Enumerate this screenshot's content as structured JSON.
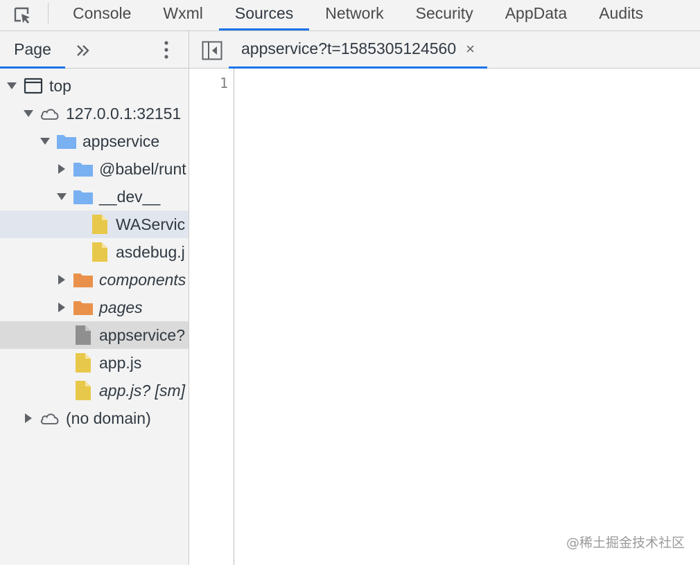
{
  "toolbar": {
    "tabs": [
      "Console",
      "Wxml",
      "Sources",
      "Network",
      "Security",
      "AppData",
      "Audits"
    ],
    "active_tab": "Sources"
  },
  "navigator": {
    "tab_label": "Page",
    "more_icon": "double-chevron-right-icon",
    "menu_icon": "kebab-menu-icon"
  },
  "tree": [
    {
      "label": "top",
      "icon": "frame-icon",
      "expanded": true
    },
    {
      "label": "127.0.0.1:32151",
      "icon": "cloud-icon",
      "expanded": true
    },
    {
      "label": "appservice",
      "icon": "folder-icon",
      "expanded": true
    },
    {
      "label": "@babel/runt",
      "icon": "folder-icon",
      "expanded": false
    },
    {
      "label": "__dev__",
      "icon": "folder-icon",
      "expanded": true
    },
    {
      "label": "WAServic",
      "icon": "js-file-icon"
    },
    {
      "label": "asdebug.j",
      "icon": "js-file-icon"
    },
    {
      "label": "components",
      "icon": "folder-icon",
      "expanded": false
    },
    {
      "label": "pages",
      "icon": "folder-icon",
      "expanded": false
    },
    {
      "label": "appservice?",
      "icon": "file-icon"
    },
    {
      "label": "app.js",
      "icon": "js-file-icon"
    },
    {
      "label": "app.js? [sm]",
      "icon": "js-file-icon"
    },
    {
      "label": "(no domain)",
      "icon": "cloud-icon",
      "expanded": false
    }
  ],
  "editor": {
    "open_tab": "appservice?t=1585305124560",
    "close_label": "×",
    "line_numbers": [
      "1"
    ]
  },
  "watermark": "@稀土掘金技术社区",
  "colors": {
    "accent": "#1a73e8",
    "folder_blue": "#78b0f2",
    "folder_orange": "#e9914a",
    "js_file": "#e8c84a",
    "selection_light": "#e1e6ee",
    "selection_grey": "#dadada"
  }
}
